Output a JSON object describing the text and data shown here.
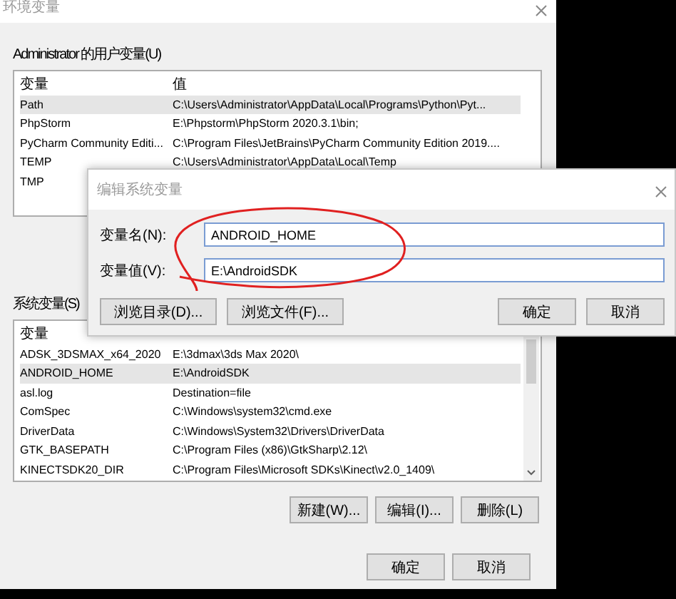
{
  "window": {
    "title": "环境变量"
  },
  "user_variables": {
    "label": "Administrator 的用户变量(U)",
    "columns": [
      "变量",
      "值"
    ],
    "rows": [
      {
        "name": "Path",
        "value": "C:\\Users\\Administrator\\AppData\\Local\\Programs\\Python\\Pyt...",
        "selected": true
      },
      {
        "name": "PhpStorm",
        "value": "E:\\Phpstorm\\PhpStorm 2020.3.1\\bin;",
        "selected": false
      },
      {
        "name": "PyCharm Community Editi...",
        "value": "C:\\Program Files\\JetBrains\\PyCharm Community Edition 2019....",
        "selected": false
      },
      {
        "name": "TEMP",
        "value": "C:\\Users\\Administrator\\AppData\\Local\\Temp",
        "selected": false
      },
      {
        "name": "TMP",
        "value": "",
        "selected": false
      }
    ]
  },
  "system_variables": {
    "label": "系统变量(S)",
    "columns": [
      "变量"
    ],
    "rows": [
      {
        "name": "ADSK_3DSMAX_x64_2020",
        "value": "E:\\3dmax\\3ds Max 2020\\",
        "selected": false
      },
      {
        "name": "ANDROID_HOME",
        "value": "E:\\AndroidSDK",
        "selected": true
      },
      {
        "name": "asl.log",
        "value": "Destination=file",
        "selected": false
      },
      {
        "name": "ComSpec",
        "value": "C:\\Windows\\system32\\cmd.exe",
        "selected": false
      },
      {
        "name": "DriverData",
        "value": "C:\\Windows\\System32\\Drivers\\DriverData",
        "selected": false
      },
      {
        "name": "GTK_BASEPATH",
        "value": "C:\\Program Files (x86)\\GtkSharp\\2.12\\",
        "selected": false
      },
      {
        "name": "KINECTSDK20_DIR",
        "value": "C:\\Program Files\\Microsoft SDKs\\Kinect\\v2.0_1409\\",
        "selected": false
      }
    ],
    "buttons": [
      "新建(W)...",
      "编辑(I)...",
      "删除(L)"
    ]
  },
  "buttons": [
    "确定",
    "取消"
  ],
  "edit_dialog": {
    "title": "编辑系统变量",
    "fields": [
      {
        "label": "变量名(N):",
        "value": "ANDROID_HOME"
      },
      {
        "label": "变量值(V):",
        "value": "E:\\AndroidSDK"
      }
    ],
    "browse_buttons": [
      "浏览目录(D)...",
      "浏览文件(F)..."
    ],
    "buttons": [
      "确定",
      "取消"
    ]
  }
}
